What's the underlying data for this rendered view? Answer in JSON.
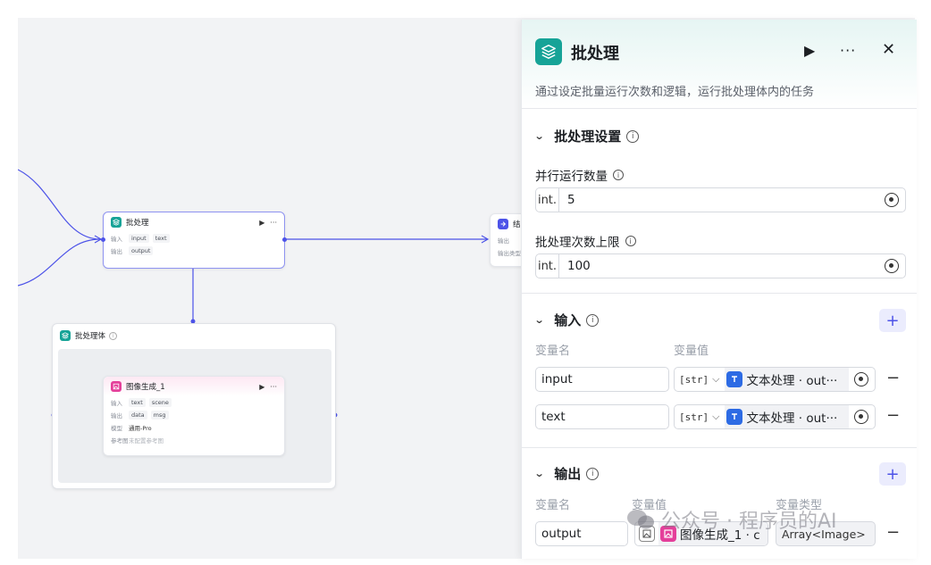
{
  "canvas": {
    "batch_node": {
      "title": "批处理",
      "input_label": "输入",
      "inputs": [
        "input",
        "text"
      ],
      "output_label": "输出",
      "outputs": [
        "output"
      ]
    },
    "batch_body": {
      "title": "批处理体"
    },
    "image_node": {
      "title": "图像生成_1",
      "input_label": "输入",
      "inputs": [
        "text",
        "scene"
      ],
      "output_label": "输出",
      "outputs": [
        "data",
        "msg"
      ],
      "model_label": "模型",
      "model": "通用-Pro",
      "ref_label": "参考图",
      "ref_value": "未配置参考图"
    },
    "end_node": {
      "title": "结",
      "out_label": "输出",
      "out_type_label": "输出类型"
    }
  },
  "panel": {
    "title": "批处理",
    "description": "通过设定批量运行次数和逻辑，运行批处理体内的任务",
    "settings": {
      "title": "批处理设置",
      "parallel_label": "并行运行数量",
      "parallel_type": "int.",
      "parallel_value": "5",
      "max_label": "批处理次数上限",
      "max_type": "int.",
      "max_value": "100"
    },
    "inputs": {
      "title": "输入",
      "col_name": "变量名",
      "col_value": "变量值",
      "rows": [
        {
          "name": "input",
          "type": "[str]",
          "source": "文本处理 · out···"
        },
        {
          "name": "text",
          "type": "[str]",
          "source": "文本处理 · out···"
        }
      ]
    },
    "outputs": {
      "title": "输出",
      "col_name": "变量名",
      "col_value": "变量值",
      "col_type": "变量类型",
      "rows": [
        {
          "name": "output",
          "source": "图像生成_1 · c",
          "type": "Array<Image>"
        }
      ]
    }
  },
  "watermark": "公众号 · 程序员的AI",
  "colors": {
    "accent": "#4d53e8",
    "teal": "#16a397",
    "pink": "#e43f9a",
    "blue": "#2d6be4"
  }
}
